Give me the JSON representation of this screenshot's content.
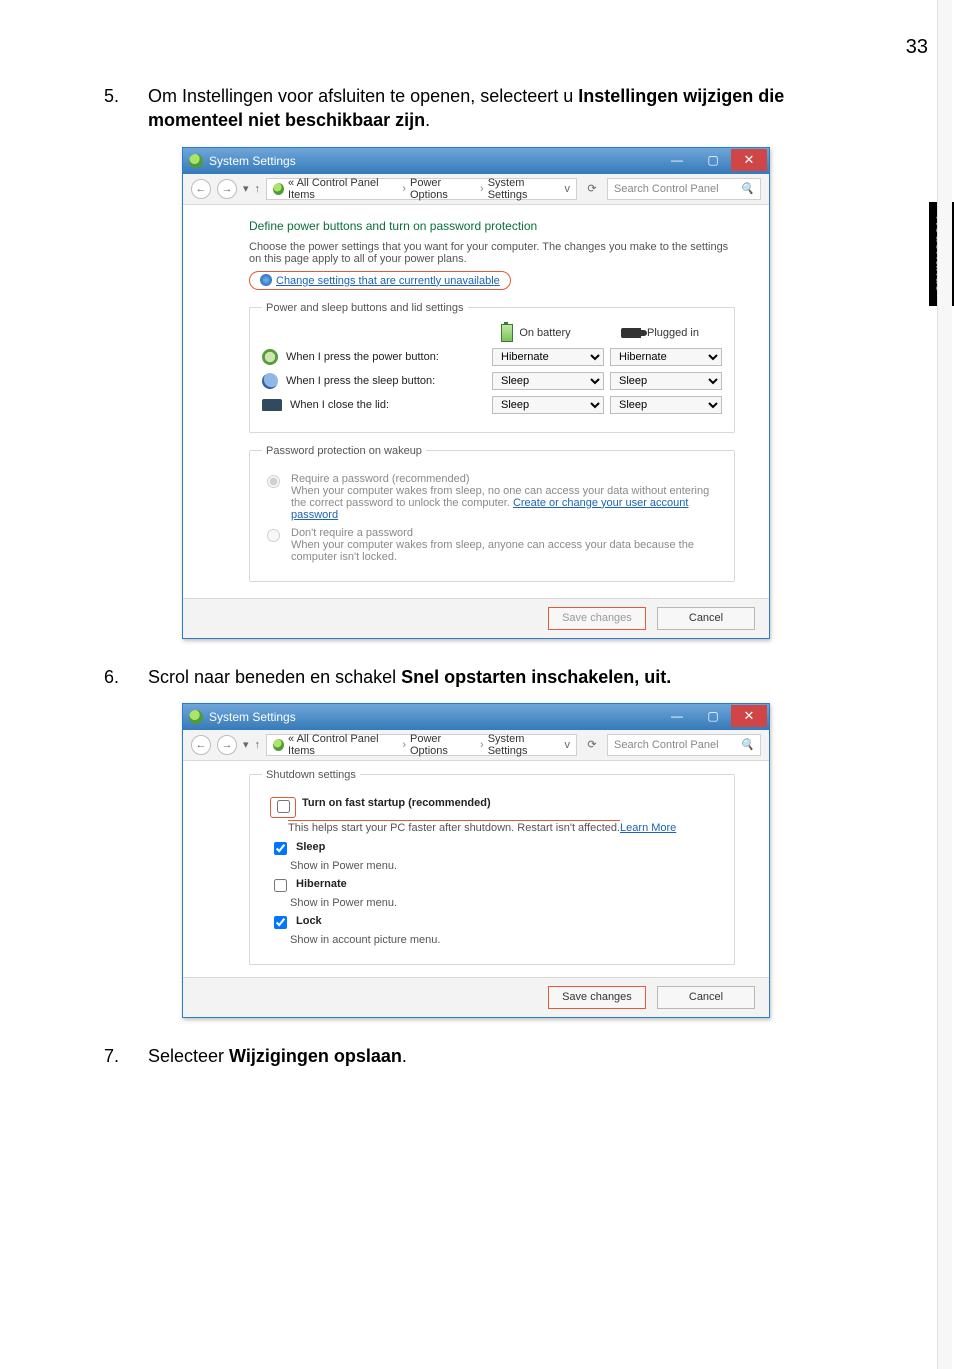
{
  "page": {
    "number": "33",
    "sidetab": "Nederlands"
  },
  "steps": {
    "s5_num": "5.",
    "s5_pre": "Om Instellingen voor afsluiten te openen, selecteert u ",
    "s5_bold": "Instellingen wijzigen die momenteel niet beschikbaar zijn",
    "s5_period": ".",
    "s6_num": "6.",
    "s6_pre": "Scrol naar beneden en schakel ",
    "s6_bold": "Snel opstarten inschakelen, uit.",
    "s7_num": "7.",
    "s7_pre": "Selecteer ",
    "s7_bold": "Wijzigingen opslaan",
    "s7_period": "."
  },
  "win": {
    "title": "System Settings",
    "breadcrumb": {
      "b1": "«  All Control Panel Items",
      "b2": "Power Options",
      "b3": "System Settings"
    },
    "search_placeholder": "Search Control Panel",
    "save": "Save changes",
    "cancel": "Cancel"
  },
  "w1": {
    "heading": "Define power buttons and turn on password protection",
    "desc": "Choose the power settings that you want for your computer. The changes you make to the settings on this page apply to all of your power plans.",
    "change_link": "Change settings that are currently unavailable",
    "group_label": "Power and sleep buttons and lid settings",
    "col_batt": "On battery",
    "col_plug": "Plugged in",
    "rows": {
      "r1": "When I press the power button:",
      "r2": "When I press the sleep button:",
      "r3": "When I close the lid:"
    },
    "opts": {
      "hibernate": "Hibernate",
      "sleep": "Sleep"
    },
    "pw_group": "Password protection on wakeup",
    "radio1": {
      "title": "Require a password (recommended)",
      "desc_a": "When your computer wakes from sleep, no one can access your data without entering the correct password to unlock the computer. ",
      "desc_link": "Create or change your user account password"
    },
    "radio2": {
      "title": "Don't require a password",
      "desc": "When your computer wakes from sleep, anyone can access your data because the computer isn't locked."
    }
  },
  "w2": {
    "group_label": "Shutdown settings",
    "fast": {
      "label": "Turn on fast startup (recommended)",
      "sub_a": "This helps start your PC faster after shutdown. Restart isn't affected. ",
      "sub_link": "Learn More"
    },
    "sleep": {
      "label": "Sleep",
      "sub": "Show in Power menu."
    },
    "hib": {
      "label": "Hibernate",
      "sub": "Show in Power menu."
    },
    "lock": {
      "label": "Lock",
      "sub": "Show in account picture menu."
    }
  }
}
